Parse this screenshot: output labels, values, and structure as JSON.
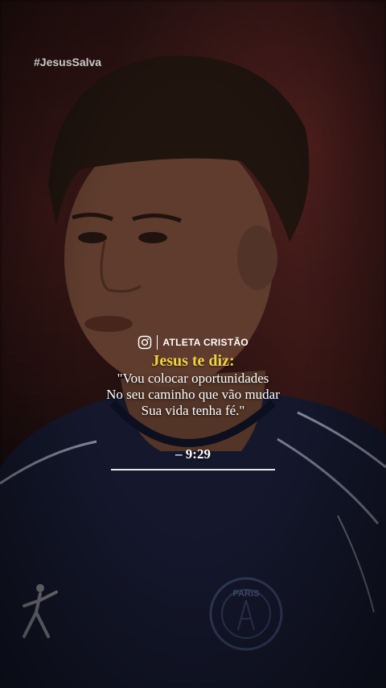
{
  "hashtag": "#JesusSalva",
  "brand": {
    "icon": "instagram-icon",
    "name": "ATLETA CRISTÃO"
  },
  "heading": "Jesus te diz:",
  "quote_lines": [
    "\"Vou colocar oportunidades",
    "No seu caminho que vão mudar",
    "Sua vida tenha fé.\""
  ],
  "reference": "– 9:29",
  "crest_text": "PARIS",
  "colors": {
    "heading": "#f4d23a",
    "text": "#ffffff",
    "jersey": "#1b1f3a"
  }
}
